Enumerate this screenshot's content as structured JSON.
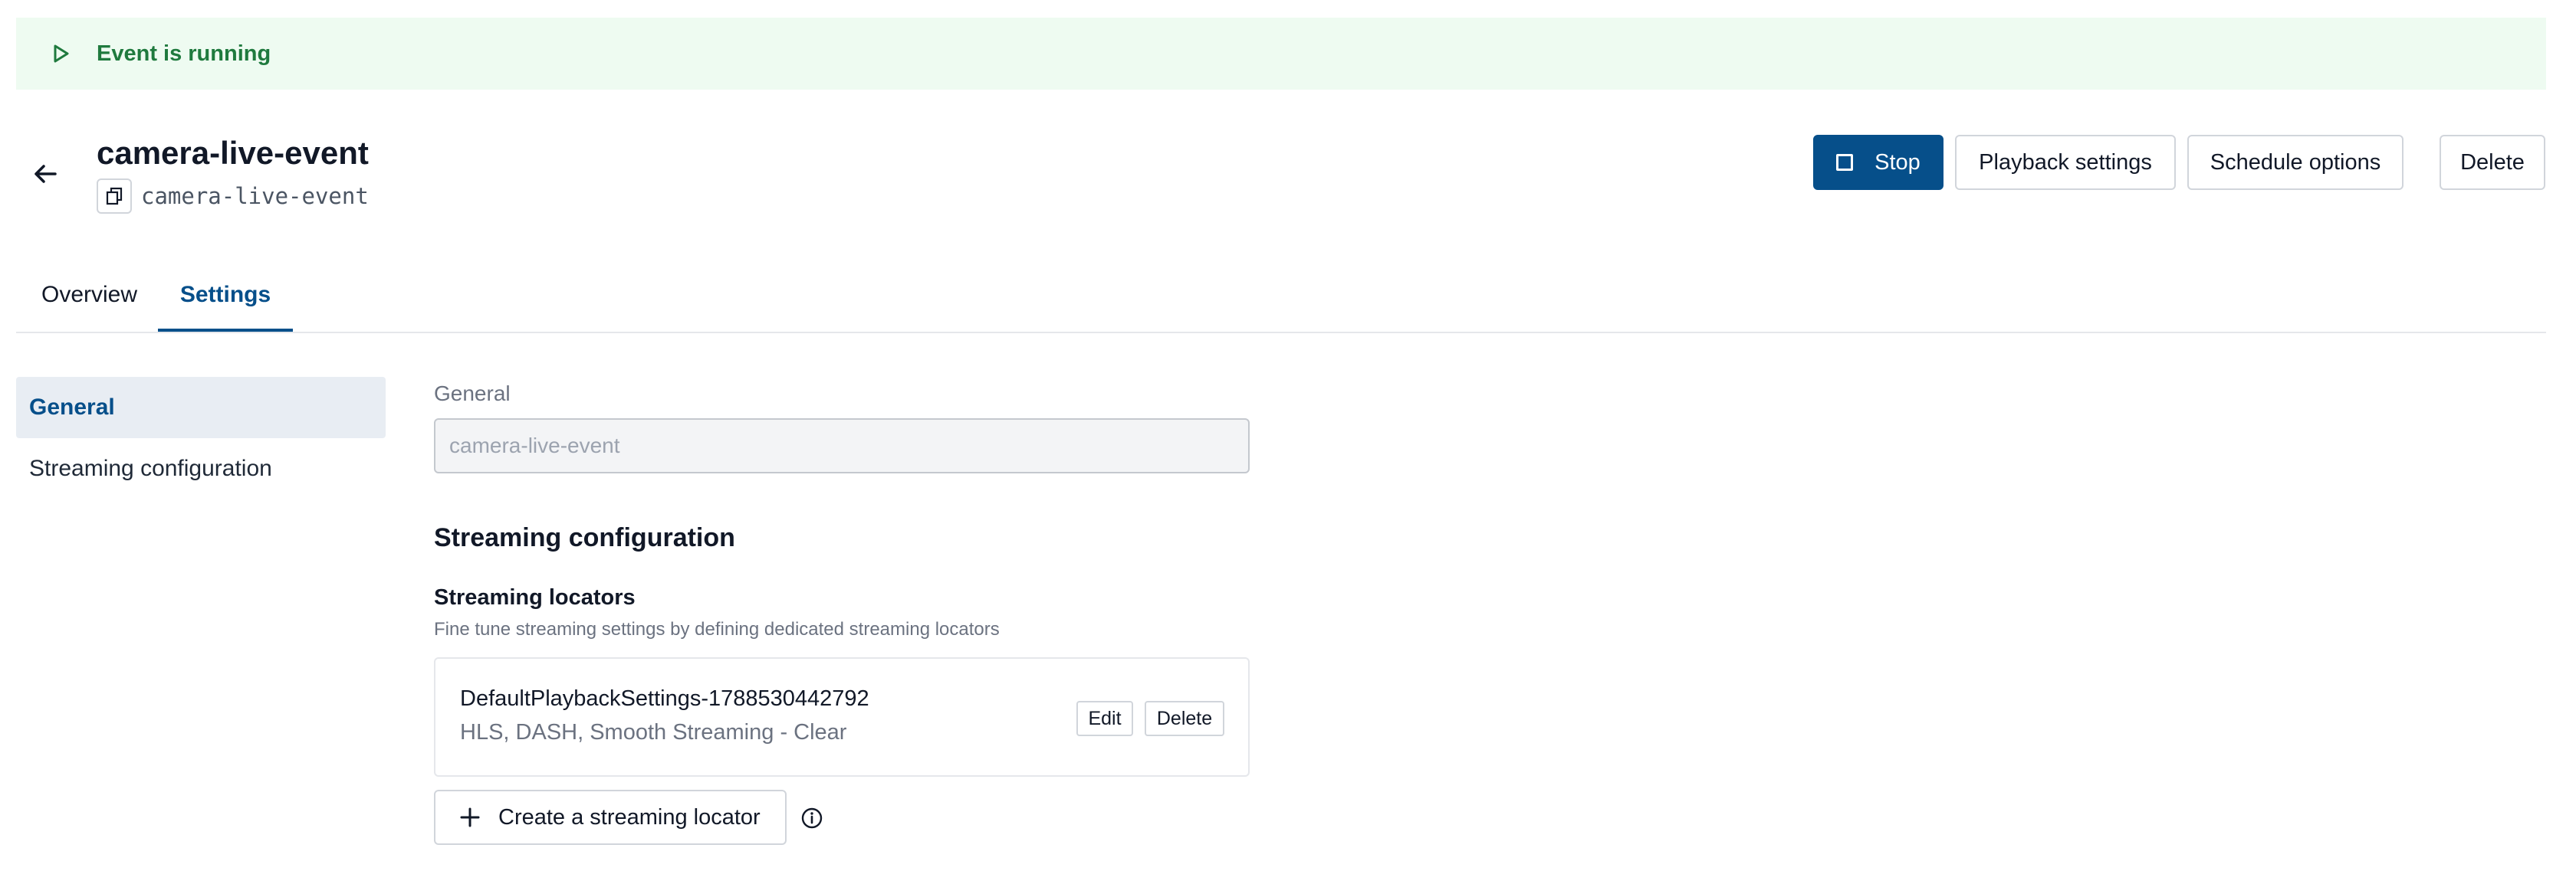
{
  "banner": {
    "status_text": "Event is running",
    "icon": "play-icon",
    "color": "#1f7a3e"
  },
  "header": {
    "back_icon": "arrow-left-icon",
    "title": "camera-live-event",
    "slug": "camera-live-event",
    "copy_icon": "copy-icon"
  },
  "actions": {
    "stop_label": "Stop",
    "playback_label": "Playback settings",
    "schedule_label": "Schedule options",
    "delete_label": "Delete"
  },
  "tabs": [
    {
      "label": "Overview",
      "active": false
    },
    {
      "label": "Settings",
      "active": true
    }
  ],
  "sidebar": {
    "items": [
      {
        "label": "General",
        "active": true
      },
      {
        "label": "Streaming configuration",
        "active": false
      }
    ]
  },
  "general": {
    "label": "General",
    "name_value": "camera-live-event"
  },
  "streaming": {
    "heading": "Streaming configuration",
    "locators_heading": "Streaming locators",
    "locators_description": "Fine tune streaming settings by defining dedicated streaming locators",
    "locators": [
      {
        "name": "DefaultPlaybackSettings-1788530442792",
        "protocols": "HLS, DASH, Smooth Streaming - Clear",
        "edit_label": "Edit",
        "delete_label": "Delete"
      }
    ],
    "create_label": "Create a streaming locator",
    "info_icon": "info-icon"
  },
  "colors": {
    "primary": "#064f8a",
    "success_bg": "#eefbf1",
    "success_text": "#1f7a3e"
  }
}
